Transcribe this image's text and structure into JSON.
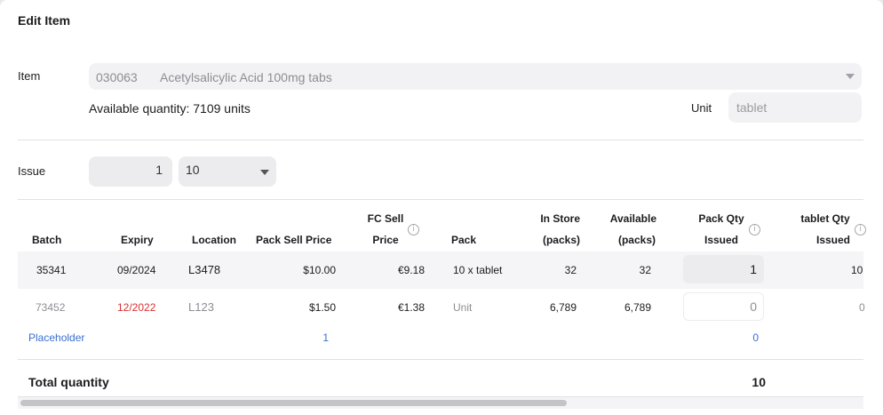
{
  "dialog": {
    "title": "Edit Item"
  },
  "item": {
    "label": "Item",
    "code": "030063",
    "name": "Acetylsalicylic Acid 100mg tabs",
    "available": "Available quantity: 7109 units",
    "unit_label": "Unit",
    "unit_value": "tablet"
  },
  "issue": {
    "label": "Issue",
    "quantity": "1",
    "pack_size": "10"
  },
  "table": {
    "headers": {
      "batch": "Batch",
      "expiry": "Expiry",
      "location": "Location",
      "pack_sell_price": "Pack Sell Price",
      "fc_sell_price_1": "FC Sell",
      "fc_sell_price_2": "Price",
      "pack": "Pack",
      "in_store_1": "In Store",
      "in_store_2": "(packs)",
      "available_1": "Available",
      "available_2": "(packs)",
      "pack_qty_1": "Pack Qty",
      "pack_qty_2": "Issued",
      "tablet_qty_1": "tablet Qty",
      "tablet_qty_2": "Issued"
    },
    "rows": [
      {
        "batch": "35341",
        "expiry": "09/2024",
        "location": "L3478",
        "pack_sell_price": "$10.00",
        "fc_sell_price": "€9.18",
        "pack": "10 x tablet",
        "in_store": "32",
        "available": "32",
        "pack_qty": "1",
        "tablet_qty": "10"
      },
      {
        "batch": "73452",
        "expiry": "12/2022",
        "location": "L123",
        "pack_sell_price": "$1.50",
        "fc_sell_price": "€1.38",
        "pack": "Unit",
        "in_store": "6,789",
        "available": "6,789",
        "pack_qty": "0",
        "tablet_qty": "0"
      }
    ],
    "placeholder": {
      "label": "Placeholder",
      "value": "1",
      "pack_qty": "0"
    },
    "total": {
      "label": "Total quantity",
      "value": "10"
    }
  },
  "colors": {
    "expired": "#d93030",
    "link": "#3a6fd1",
    "input_bg": "#ececef"
  },
  "icons": {
    "dropdown": "chevron-down-icon",
    "info": "info-icon"
  }
}
